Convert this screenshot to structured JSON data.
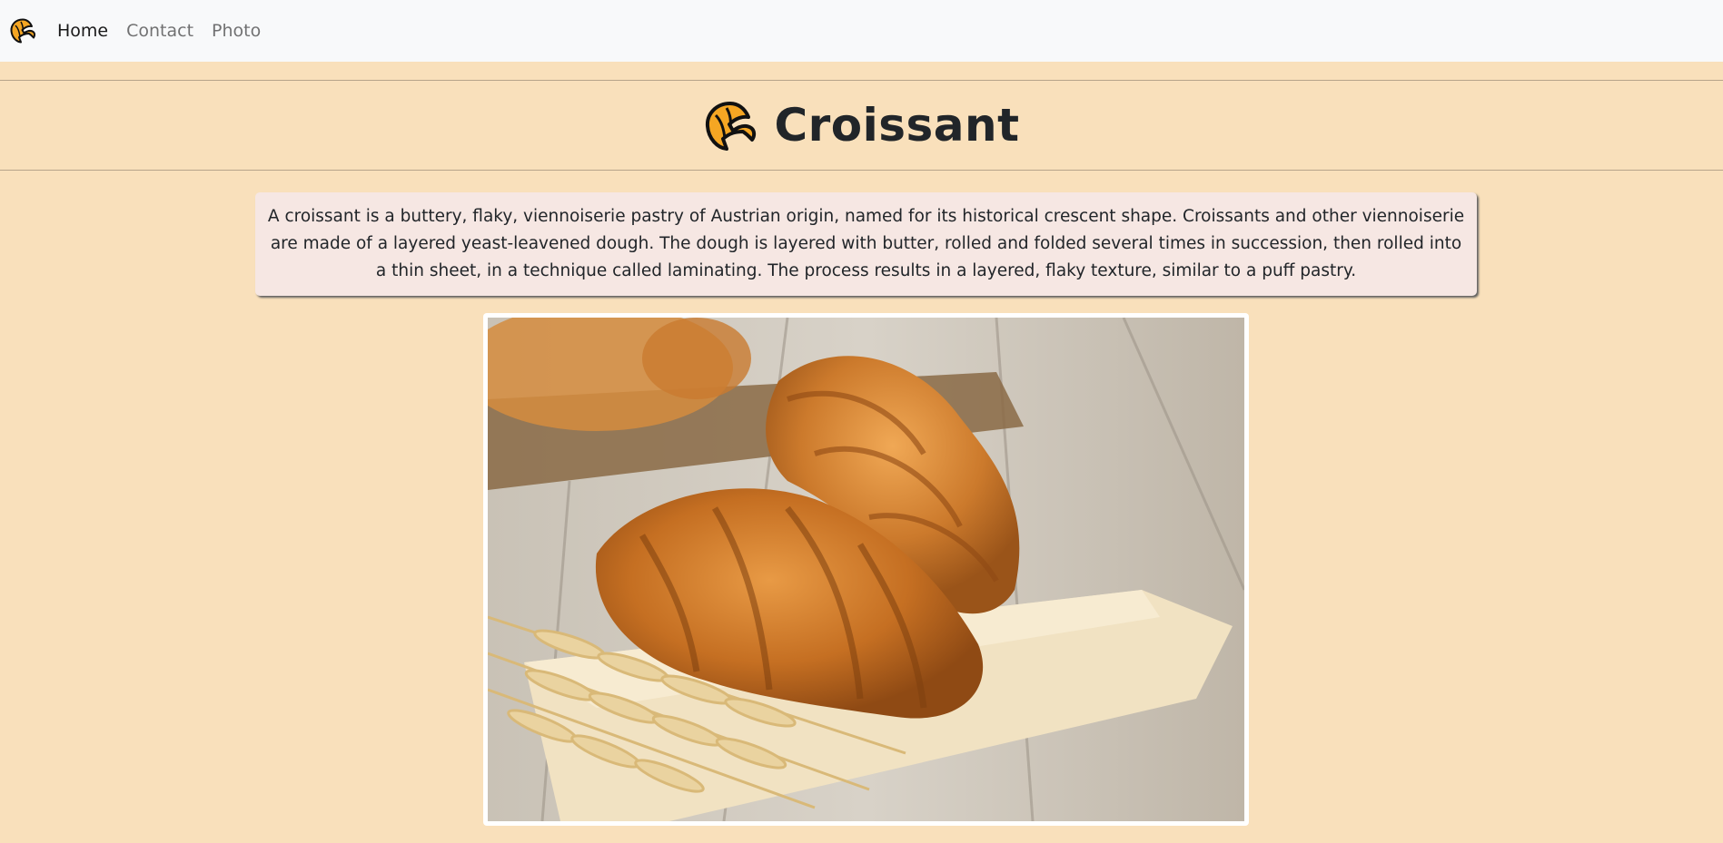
{
  "nav": {
    "logo_icon": "croissant-icon",
    "links": [
      {
        "label": "Home",
        "active": true
      },
      {
        "label": "Contact",
        "active": false
      },
      {
        "label": "Photo",
        "active": false
      }
    ]
  },
  "header": {
    "title": "Croissant",
    "icon": "croissant-icon"
  },
  "description": "A croissant is a buttery, flaky, viennoiserie pastry of Austrian origin, named for its historical crescent shape. Croissants and other viennoiserie are made of a layered yeast-leavened dough. The dough is layered with butter, rolled and folded several times in succession, then rolled into a thin sheet, in a technique called laminating. The process results in a layered, flaky texture, similar to a puff pastry.",
  "photo": {
    "subject": "croissants-on-wooden-table-photo"
  },
  "colors": {
    "page_background": "#f9e0bb",
    "navbar_background": "#f8f9fa",
    "description_background": "#f6e7e3",
    "logo_fill": "#f5a623"
  }
}
